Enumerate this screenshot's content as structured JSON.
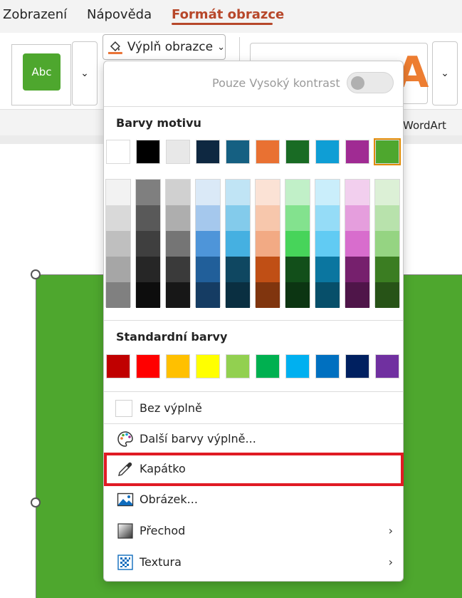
{
  "tabs": [
    "Zobrazení",
    "Nápověda",
    "Formát obrazce"
  ],
  "ribbon": {
    "gallery_sample": "Abc",
    "dropdown_glyph": "⌄",
    "fill_button_label": "Výplň obrazce",
    "fill_button_chevron": "⌄",
    "wordart_label": "WordArt",
    "wordart_glyph": "A"
  },
  "menu": {
    "high_contrast_label": "Pouze Vysoký kontrast",
    "high_contrast_on": false,
    "theme_title": "Barvy motivu",
    "standard_title": "Standardní barvy",
    "theme_colors": [
      "#ffffff",
      "#000000",
      "#e8e8e8",
      "#0e2841",
      "#156082",
      "#e97132",
      "#196b24",
      "#0f9ed5",
      "#a02b93",
      "#4ea72e"
    ],
    "selected_theme_color": 9,
    "shades": [
      [
        "#f2f2f2",
        "#d9d9d9",
        "#bfbfbf",
        "#a6a6a6",
        "#808080"
      ],
      [
        "#7f7f7f",
        "#595959",
        "#3f3f3f",
        "#262626",
        "#0d0d0d"
      ],
      [
        "#d0d0d0",
        "#aeaeae",
        "#757575",
        "#3a3a3a",
        "#171717"
      ],
      [
        "#dae9f7",
        "#a5c8ed",
        "#4e95d9",
        "#215f9a",
        "#153c63"
      ],
      [
        "#c0e4f5",
        "#83cbeb",
        "#45b0e1",
        "#0f4761",
        "#0a2f41"
      ],
      [
        "#fbe2d5",
        "#f7c7ac",
        "#f2aa84",
        "#c04f15",
        "#80350e"
      ],
      [
        "#c1f0c8",
        "#83e28e",
        "#47d45a",
        "#124f1a",
        "#0c3512"
      ],
      [
        "#caeefb",
        "#95dcf7",
        "#61cbf3",
        "#0b76a0",
        "#074f6a"
      ],
      [
        "#f2cfee",
        "#e59edd",
        "#d86dcd",
        "#76206d",
        "#4f1549"
      ],
      [
        "#dcf0d6",
        "#b8e2ac",
        "#95d482",
        "#3b7d22",
        "#275317"
      ]
    ],
    "standard_colors": [
      "#c00000",
      "#ff0000",
      "#ffc000",
      "#ffff00",
      "#92d050",
      "#00b050",
      "#00b0f0",
      "#0070c0",
      "#002060",
      "#7030a0"
    ],
    "items": [
      {
        "label": "Bez výplně",
        "icon": "no-fill-icon"
      },
      {
        "label": "Další barvy výplně...",
        "icon": "palette-icon"
      },
      {
        "label": "Kapátko",
        "icon": "eyedropper-icon",
        "highlighted": true
      },
      {
        "label": "Obrázek...",
        "icon": "picture-icon"
      },
      {
        "label": "Přechod",
        "icon": "gradient-icon",
        "submenu": true
      },
      {
        "label": "Textura",
        "icon": "texture-icon",
        "submenu": true
      }
    ],
    "submenu_glyph": "›"
  }
}
